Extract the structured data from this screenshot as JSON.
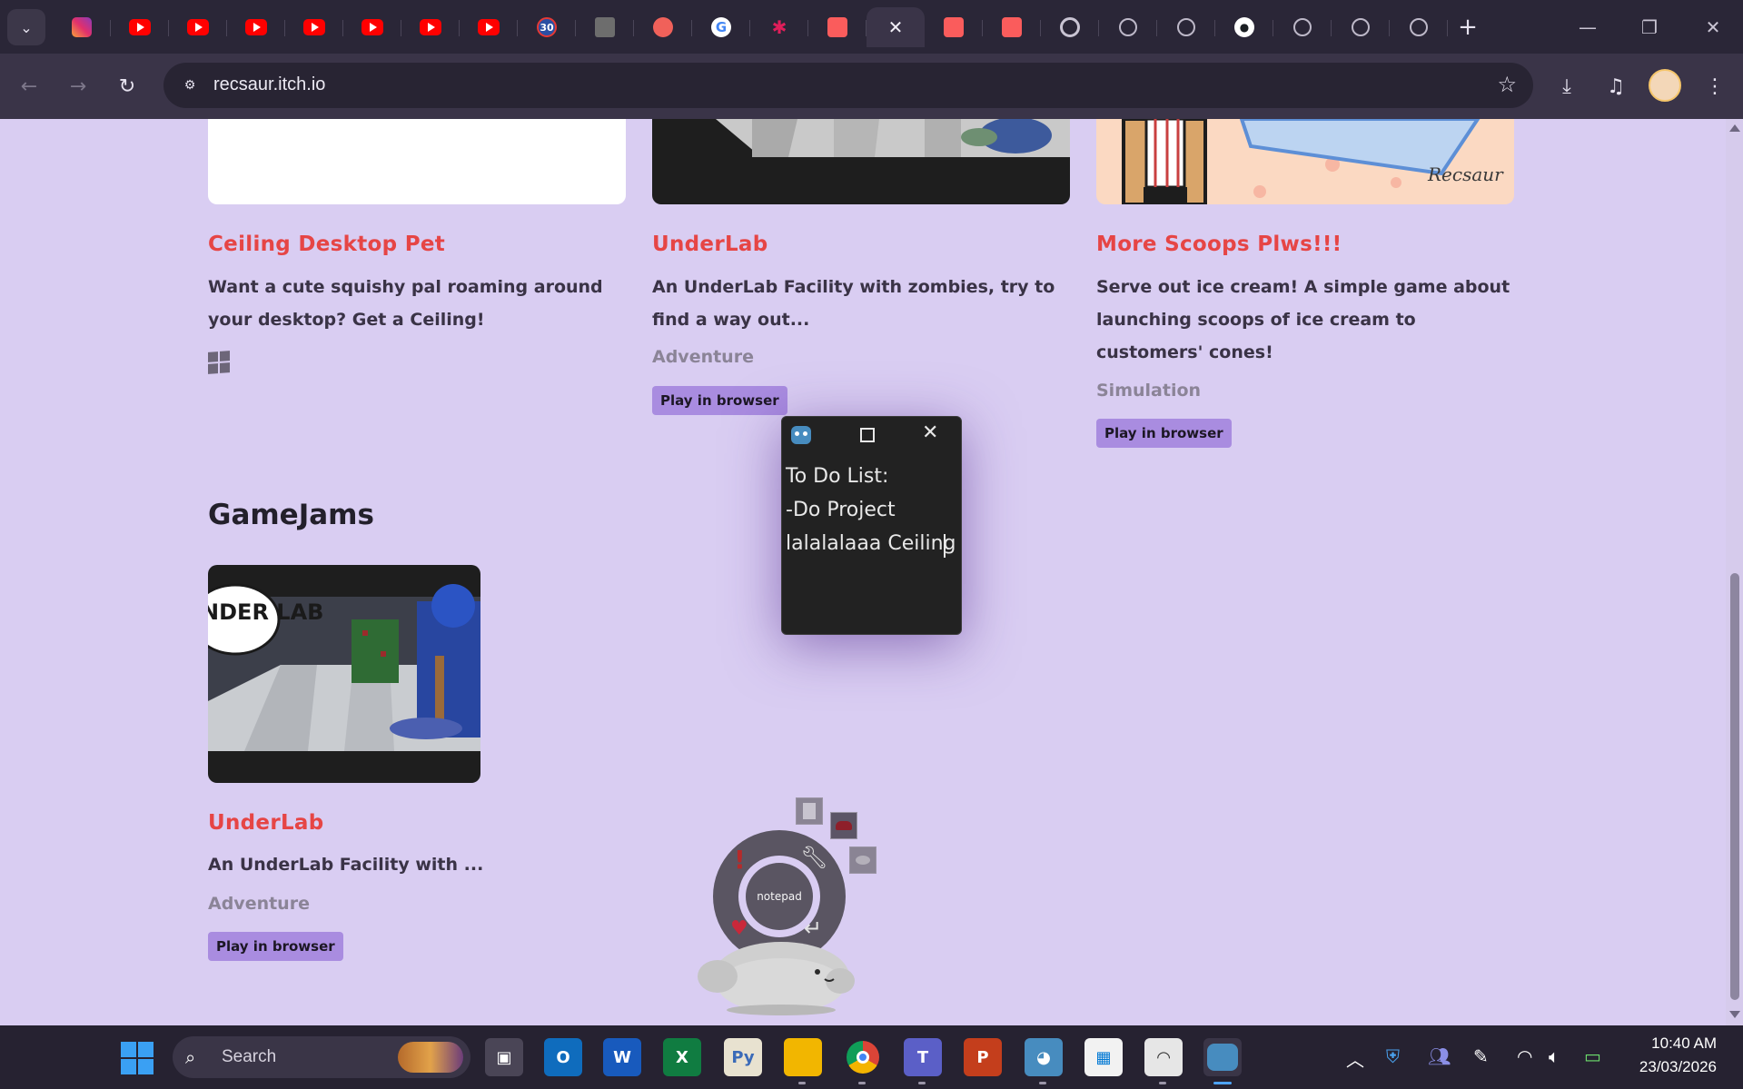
{
  "browser": {
    "url": "recsaur.itch.io",
    "tabs": [
      {
        "icon": "instagram-icon",
        "label": ""
      },
      {
        "icon": "youtube-icon",
        "label": ""
      },
      {
        "icon": "youtube-icon",
        "label": ""
      },
      {
        "icon": "youtube-icon",
        "label": ""
      },
      {
        "icon": "youtube-icon",
        "label": ""
      },
      {
        "icon": "youtube-icon",
        "label": ""
      },
      {
        "icon": "youtube-icon",
        "label": ""
      },
      {
        "icon": "youtube-icon",
        "label": ""
      },
      {
        "icon": "calendar-icon",
        "label": "30"
      },
      {
        "icon": "grid-icon",
        "label": ""
      },
      {
        "icon": "kofi-icon",
        "label": ""
      },
      {
        "icon": "google-icon",
        "label": "G"
      },
      {
        "icon": "slack-icon",
        "label": ""
      },
      {
        "icon": "itch-icon",
        "label": ""
      },
      {
        "icon": "close-icon",
        "label": ""
      },
      {
        "icon": "itch-icon",
        "label": ""
      },
      {
        "icon": "itch-icon",
        "label": ""
      },
      {
        "icon": "chrome-icon",
        "label": ""
      },
      {
        "icon": "globe-icon",
        "label": ""
      },
      {
        "icon": "globe-icon",
        "label": ""
      },
      {
        "icon": "github-icon",
        "label": ""
      },
      {
        "icon": "globe-icon",
        "label": ""
      },
      {
        "icon": "globe-icon",
        "label": ""
      },
      {
        "icon": "globe-icon",
        "label": ""
      }
    ]
  },
  "games_row": [
    {
      "title": "Ceiling Desktop Pet",
      "description": "Want a cute squishy pal roaming around your desktop? Get a Ceiling!",
      "genre": "",
      "platform_icon": "windows-icon",
      "button": ""
    },
    {
      "title": "UnderLab",
      "description": "An UnderLab Facility with zombies, try to find a way out...",
      "genre": "Adventure",
      "button": "Play in browser"
    },
    {
      "title": "More Scoops Plws!!!",
      "description": "Serve out ice cream! A simple game about launching scoops of ice cream to customers' cones!",
      "genre": "Simulation",
      "button": "Play in browser"
    }
  ],
  "gamejams": {
    "heading": "GameJams",
    "cover_text": "UNDER LAB",
    "title": "UnderLab",
    "description": "An UnderLab Facility with ...",
    "genre": "Adventure",
    "button": "Play in browser"
  },
  "cover_signature": "Recsaur",
  "notepad": {
    "text": "To Do List:\n-Do Project\nlalalalaaa Ceiling"
  },
  "pet": {
    "center_label": "notepad",
    "tools": [
      "notepad-icon",
      "turtle-icon",
      "fish-icon",
      "wrench-icon",
      "exclamation-icon",
      "heart-icon",
      "return-icon"
    ]
  },
  "taskbar": {
    "search_label": "Search",
    "time": "10:40 AM",
    "date": "23/03/2026"
  },
  "colors": {
    "page_bg": "#d9cdf2",
    "title_red": "#e64545",
    "button_purple": "#a98ce0"
  }
}
